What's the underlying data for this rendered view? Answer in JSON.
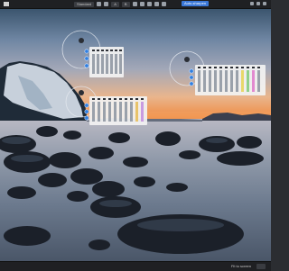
{
  "toolbar": {
    "mode_label": "Standard",
    "tab_a": "B",
    "tab_b": "A",
    "action_label": "Auto-sharpen"
  },
  "status": {
    "zoom": "Fit to screen"
  }
}
